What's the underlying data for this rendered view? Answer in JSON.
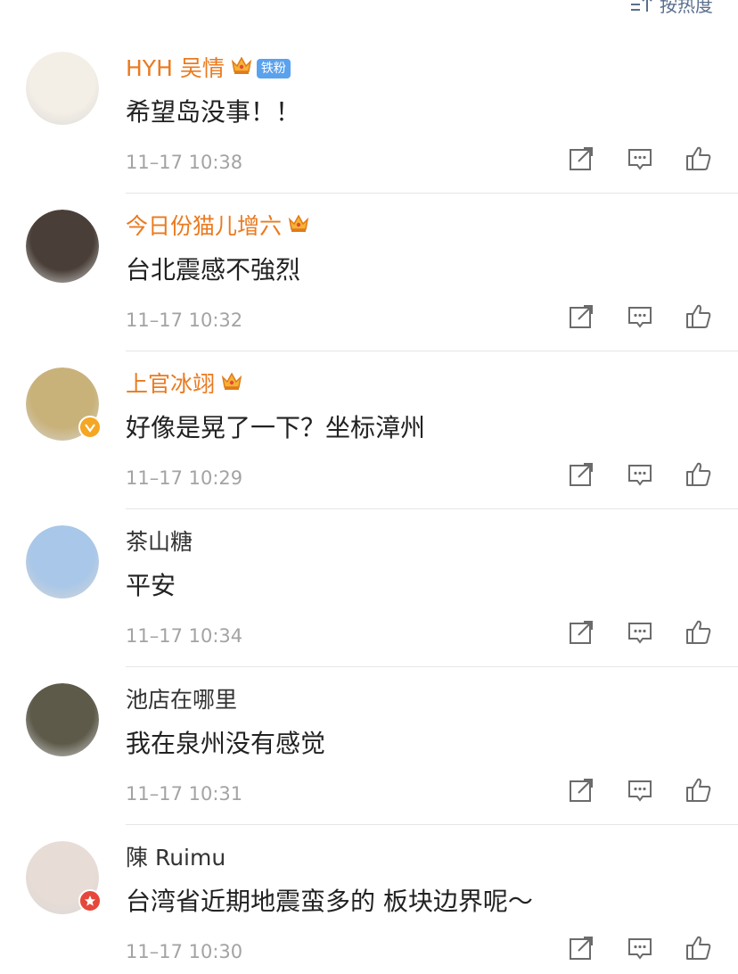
{
  "sort": {
    "label": "按热度",
    "icon": "sort-icon"
  },
  "comments": [
    {
      "name": "HYH 吴情",
      "vip": true,
      "tag": "铁粉",
      "text": "希望岛没事！！",
      "time": "11–17 10:38",
      "avatar_color": "#f4efe6",
      "badge": ""
    },
    {
      "name": "今日份猫儿增六",
      "vip": true,
      "tag": "",
      "text": "台北震感不強烈",
      "time": "11–17 10:32",
      "avatar_color": "#4a3f38",
      "badge": ""
    },
    {
      "name": "上官冰翊",
      "vip": true,
      "tag": "",
      "text": "好像是晃了一下？坐标漳州",
      "time": "11–17 10:29",
      "avatar_color": "#c9b27a",
      "badge": "verified"
    },
    {
      "name": "茶山糖",
      "vip": false,
      "tag": "",
      "text": "平安",
      "time": "11–17 10:34",
      "avatar_color": "#a9c7e8",
      "badge": ""
    },
    {
      "name": "池店在哪里",
      "vip": false,
      "tag": "",
      "text": "我在泉州没有感觉",
      "time": "11–17 10:31",
      "avatar_color": "#5d5a4a",
      "badge": ""
    },
    {
      "name": "陳 Ruimu",
      "vip": false,
      "tag": "",
      "text": "台湾省近期地震蛮多的  板块边界呢～",
      "time": "11–17 10:30",
      "avatar_color": "#e8dcd6",
      "badge": "red"
    }
  ],
  "colors": {
    "vip_name": "#ea7a1f",
    "time": "#a3a3a3",
    "tag_bg": "#5ba2ee",
    "verified": "#f5a623",
    "red_badge": "#e5483a"
  },
  "action_icons": [
    "share-icon",
    "comment-icon",
    "like-icon"
  ]
}
